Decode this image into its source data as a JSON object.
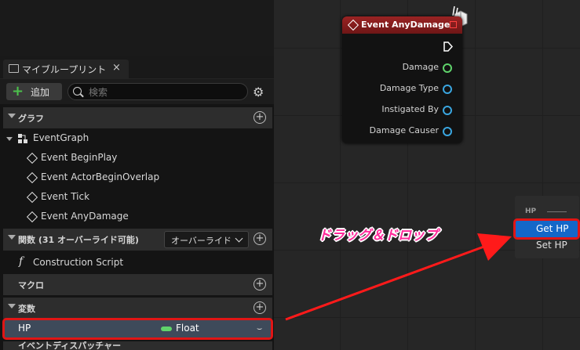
{
  "window": {
    "tab_title": "マイブループリント",
    "tab_close": "×"
  },
  "toolbar": {
    "add_label": "追加",
    "search_placeholder": "検索"
  },
  "sections": {
    "graph": "グラフ",
    "functions": "関数 (31 オーバーライド可能)",
    "override_dropdown": "オーバーライド",
    "macros": "マクロ",
    "variables": "変数",
    "dispatchers": "イベントディスパッチャー"
  },
  "tree": {
    "event_graph": "EventGraph",
    "events": [
      "Event BeginPlay",
      "Event ActorBeginOverlap",
      "Event Tick",
      "Event AnyDamage"
    ],
    "construction_script": "Construction Script"
  },
  "variable": {
    "name": "HP",
    "type": "Float",
    "type_color": "#5fd36b"
  },
  "node": {
    "title": "Event AnyDamage",
    "header_color": "#8a1c1c",
    "pins": [
      {
        "label": "Damage",
        "color": "#5fd36b"
      },
      {
        "label": "Damage Type",
        "color": "#3aa6e0"
      },
      {
        "label": "Instigated By",
        "color": "#3aa6e0"
      },
      {
        "label": "Damage Causer",
        "color": "#3aa6e0"
      }
    ]
  },
  "context_menu": {
    "category": "HP",
    "items": [
      "Get HP",
      "Set HP"
    ]
  },
  "annotation": {
    "text": "ドラッグ＆ドロップ",
    "color": "#ff2a9a",
    "arrow_color": "#ff1a1a"
  },
  "icons": [
    "book-icon",
    "plus-icon",
    "search-icon",
    "gear-icon",
    "event-graph-icon",
    "event-diamond-icon",
    "function-icon",
    "exec-pin-icon",
    "pin-icon"
  ]
}
